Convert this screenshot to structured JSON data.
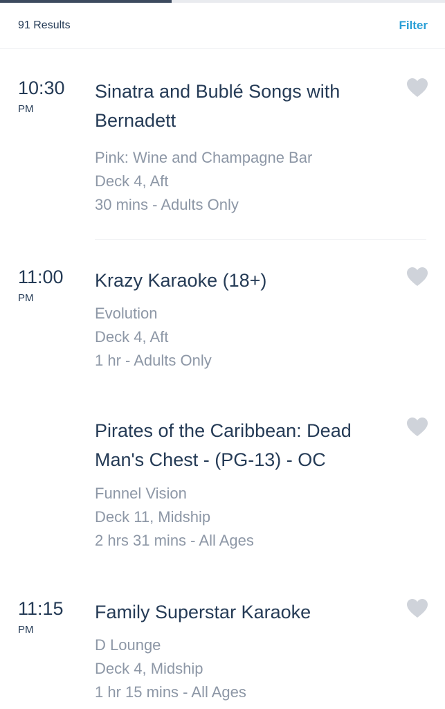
{
  "results": {
    "count_label": "91 Results",
    "filter_label": "Filter"
  },
  "loading": {
    "progress_fraction": 0.386
  },
  "events": [
    {
      "time": "10:30",
      "ampm": "PM",
      "title": "Sinatra and Bublé Songs with Bernadett",
      "location": "Pink: Wine and Champagne Bar",
      "deck": "Deck 4, Aft",
      "duration": "30 mins - Adults Only"
    },
    {
      "time": "11:00",
      "ampm": "PM",
      "title": "Krazy Karaoke (18+)",
      "location": "Evolution",
      "deck": "Deck 4, Aft",
      "duration": "1 hr - Adults Only"
    },
    {
      "time": "",
      "ampm": "",
      "title": "Pirates of the Caribbean: Dead Man's Chest - (PG-13) - OC",
      "location": "Funnel Vision",
      "deck": "Deck 11, Midship",
      "duration": "2 hrs 31 mins - All Ages"
    },
    {
      "time": "11:15",
      "ampm": "PM",
      "title": "Family Superstar Karaoke",
      "location": "D Lounge",
      "deck": "Deck 4, Midship",
      "duration": "1 hr 15 mins - All Ages"
    }
  ],
  "icons": {
    "favorite": "heart-icon"
  },
  "colors": {
    "accent": "#2a9fd6",
    "text": "#253b56",
    "muted": "#8d97a6",
    "heart": "#cfd3da"
  }
}
